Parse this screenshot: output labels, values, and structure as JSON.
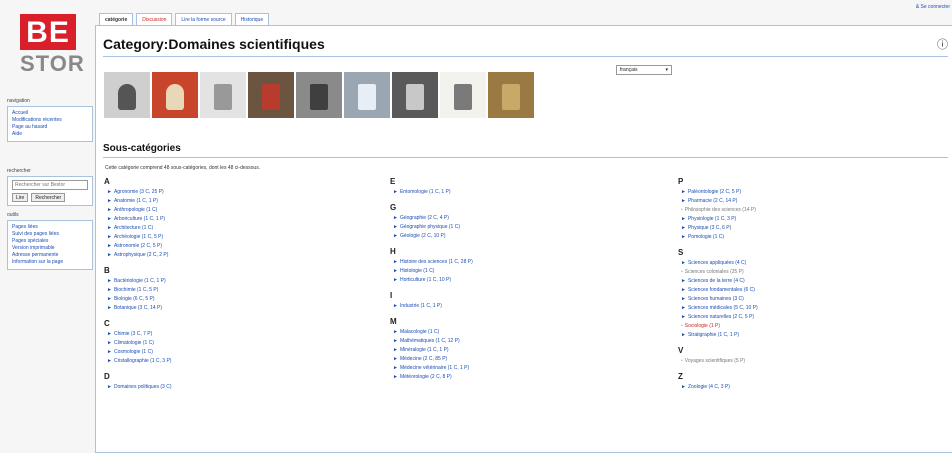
{
  "logo": {
    "top": "BE",
    "bottom": "STOR"
  },
  "user_link": "& Se connecter",
  "tabs": [
    {
      "label": "catégorie",
      "state": "active"
    },
    {
      "label": "Discussion",
      "state": "new"
    },
    {
      "label": "Lire la forme source",
      "state": "normal"
    },
    {
      "label": "Historique",
      "state": "normal"
    }
  ],
  "sidebar": {
    "nav_title": "navigation",
    "nav_items": [
      "Accueil",
      "Modifications récentes",
      "Page au hasard",
      "Aide"
    ],
    "search_title": "rechercher",
    "search_placeholder": "Rechercher sur Bestor",
    "search_go": "Lire",
    "search_btn": "Rechercher",
    "tools_title": "outils",
    "tools_items": [
      "Pages liées",
      "Suivi des pages liées",
      "Pages spéciales",
      "Version imprimable",
      "Adresse permanente",
      "Information sur la page"
    ]
  },
  "main": {
    "title": "Category:Domaines scientifiques",
    "help_icon": "?",
    "language": "français",
    "section_title": "Sous-catégories",
    "intro": "Cette catégorie comprend 48 sous-catégories, dont les 48 ci-dessous."
  },
  "columns": [
    [
      {
        "letter": "A",
        "items": [
          {
            "text": "Agronomie (3 C, 25 P)",
            "style": "link"
          },
          {
            "text": "Anatomie (1 C, 1 P)",
            "style": "link"
          },
          {
            "text": "Anthropologie (1 C)",
            "style": "link"
          },
          {
            "text": "Arboriculture (1 C, 1 P)",
            "style": "link"
          },
          {
            "text": "Architecture (1 C)",
            "style": "link"
          },
          {
            "text": "Archéologie (1 C, 5 P)",
            "style": "link"
          },
          {
            "text": "Astronomie (2 C, 5 P)",
            "style": "link"
          },
          {
            "text": "Astrophysique (2 C, 2 P)",
            "style": "link"
          }
        ]
      },
      {
        "letter": "B",
        "items": [
          {
            "text": "Bactériologie (1 C, 1 P)",
            "style": "link"
          },
          {
            "text": "Biochimie (1 C, 5 P)",
            "style": "link"
          },
          {
            "text": "Biologie (6 C, 5 P)",
            "style": "link"
          },
          {
            "text": "Botanique (3 C, 14 P)",
            "style": "link"
          }
        ]
      },
      {
        "letter": "C",
        "items": [
          {
            "text": "Chimie (3 C, 7 P)",
            "style": "link"
          },
          {
            "text": "Climatologie (1 C)",
            "style": "link"
          },
          {
            "text": "Cosmologie (1 C)",
            "style": "link"
          },
          {
            "text": "Cristallographie (1 C, 3 P)",
            "style": "link"
          }
        ]
      },
      {
        "letter": "D",
        "items": [
          {
            "text": "Domaines politiques (3 C)",
            "style": "link"
          }
        ]
      }
    ],
    [
      {
        "letter": "E",
        "items": [
          {
            "text": "Entomologie (1 C, 1 P)",
            "style": "link"
          }
        ]
      },
      {
        "letter": "G",
        "items": [
          {
            "text": "Géographie (2 C, 4 P)",
            "style": "link"
          },
          {
            "text": "Géographie physique (1 C)",
            "style": "link"
          },
          {
            "text": "Géologie (2 C, 10 P)",
            "style": "link"
          }
        ]
      },
      {
        "letter": "H",
        "items": [
          {
            "text": "Histoire des sciences (1 C, 28 P)",
            "style": "link"
          },
          {
            "text": "Histologie (1 C)",
            "style": "link"
          },
          {
            "text": "Horticulture (1 C, 10 P)",
            "style": "link"
          }
        ]
      },
      {
        "letter": "I",
        "items": [
          {
            "text": "Industrie (1 C, 1 P)",
            "style": "link"
          }
        ]
      },
      {
        "letter": "M",
        "items": [
          {
            "text": "Malacologie (1 C)",
            "style": "link"
          },
          {
            "text": "Mathématiques (1 C, 12 P)",
            "style": "link"
          },
          {
            "text": "Minéralogie (1 C, 1 P)",
            "style": "link"
          },
          {
            "text": "Médecine (2 C, 85 P)",
            "style": "link"
          },
          {
            "text": "Médecine vétérinaire (1 C, 1 P)",
            "style": "link"
          },
          {
            "text": "Météorologie (2 C, 8 P)",
            "style": "link"
          }
        ]
      }
    ],
    [
      {
        "letter": "P",
        "items": [
          {
            "text": "Paléontologie (2 C, 5 P)",
            "style": "link"
          },
          {
            "text": "Pharmacie (2 C, 14 P)",
            "style": "link"
          },
          {
            "text": "Philosophie des sciences (14 P)",
            "style": "plain"
          },
          {
            "text": "Physiologie (1 C, 3 P)",
            "style": "link"
          },
          {
            "text": "Physique (3 C, 6 P)",
            "style": "link"
          },
          {
            "text": "Pomologie (1 C)",
            "style": "link"
          }
        ]
      },
      {
        "letter": "S",
        "items": [
          {
            "text": "Sciences appliquées (4 C)",
            "style": "link"
          },
          {
            "text": "Sciences coloniales (25 P)",
            "style": "plain"
          },
          {
            "text": "Sciences de la terre (4 C)",
            "style": "link"
          },
          {
            "text": "Sciences fondamentales (6 C)",
            "style": "link"
          },
          {
            "text": "Sciences humaines (3 C)",
            "style": "link"
          },
          {
            "text": "Sciences médicales (5 C, 10 P)",
            "style": "link"
          },
          {
            "text": "Sciences naturelles (2 C, 5 P)",
            "style": "link"
          },
          {
            "text": "Sociologie (1 P)",
            "style": "red"
          },
          {
            "text": "Stratigraphie (1 C, 1 P)",
            "style": "link"
          }
        ]
      },
      {
        "letter": "V",
        "items": [
          {
            "text": "Voyages scientifiques (5 P)",
            "style": "plain"
          }
        ]
      },
      {
        "letter": "Z",
        "items": [
          {
            "text": "Zoologie (4 C, 3 P)",
            "style": "link"
          }
        ]
      }
    ]
  ],
  "colors": {
    "brand": "#d81f2a",
    "link": "#1a4db3",
    "border": "#aac2e0",
    "redlink": "#cc2222"
  },
  "gallery": [
    {
      "name": "portrait-thumb",
      "bg": "#cfcfcf",
      "fg": "#555555"
    },
    {
      "name": "microscope-thumb",
      "bg": "#c8452c",
      "fg": "#e9d8b8"
    },
    {
      "name": "building-thumb",
      "bg": "#e3e3e3",
      "fg": "#999999"
    },
    {
      "name": "exhibition-thumb",
      "bg": "#6b5540",
      "fg": "#b83b2e"
    },
    {
      "name": "group-photo-thumb",
      "bg": "#8a8a8a",
      "fg": "#3f3f3f"
    },
    {
      "name": "atomium-thumb",
      "bg": "#9aa6b2",
      "fg": "#e8eef5"
    },
    {
      "name": "street-thumb",
      "bg": "#5a5a5a",
      "fg": "#c8c8c8"
    },
    {
      "name": "document-thumb",
      "bg": "#f4f2ec",
      "fg": "#7a7a7a"
    },
    {
      "name": "gold-medal-thumb",
      "bg": "#9a7a42",
      "fg": "#c9a868"
    }
  ]
}
